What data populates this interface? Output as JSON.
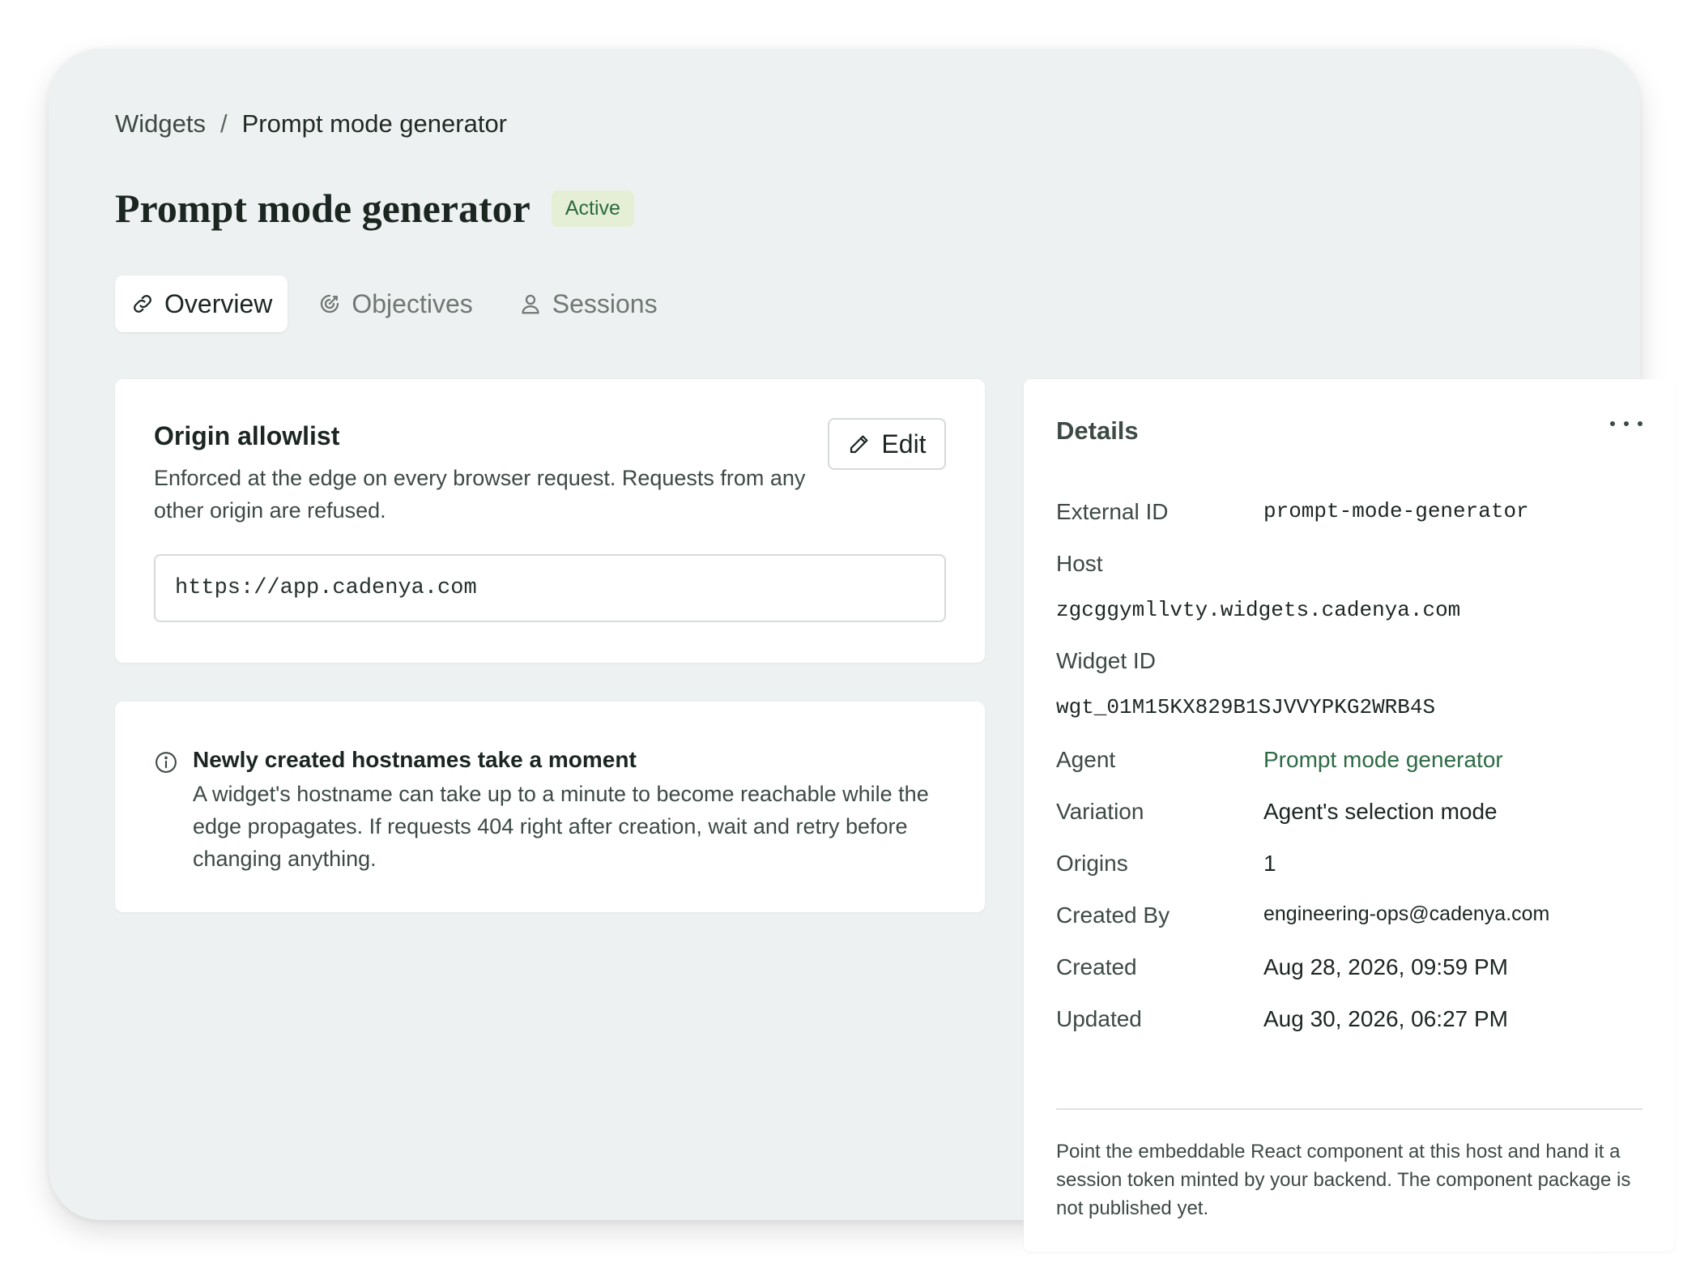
{
  "breadcrumb": {
    "parent": "Widgets",
    "separator": "/",
    "current": "Prompt mode generator"
  },
  "header": {
    "title": "Prompt mode generator",
    "status": "Active"
  },
  "tabs": [
    {
      "label": "Overview",
      "icon": "link-icon",
      "active": true
    },
    {
      "label": "Objectives",
      "icon": "target-icon",
      "active": false
    },
    {
      "label": "Sessions",
      "icon": "user-icon",
      "active": false
    }
  ],
  "allowlist": {
    "title": "Origin allowlist",
    "description": "Enforced at the edge on every browser request. Requests from any other origin are refused.",
    "edit_label": "Edit",
    "origin_value": "https://app.cadenya.com"
  },
  "note": {
    "title": "Newly created hostnames take a moment",
    "body": "A widget's hostname can take up to a minute to become reachable while the edge propagates. If requests 404 right after creation, wait and retry before changing anything."
  },
  "details": {
    "title": "Details",
    "external_id_label": "External ID",
    "external_id": "prompt-mode-generator",
    "host_label": "Host",
    "host": "zgcggymllvty.widgets.cadenya.com",
    "widget_id_label": "Widget ID",
    "widget_id": "wgt_01M15KX829B1SJVVYPKG2WRB4S",
    "agent_label": "Agent",
    "agent": "Prompt mode generator",
    "variation_label": "Variation",
    "variation": "Agent's selection mode",
    "origins_label": "Origins",
    "origins": "1",
    "created_by_label": "Created By",
    "created_by": "engineering-ops@cadenya.com",
    "created_label": "Created",
    "created": "Aug 28, 2026, 09:59 PM",
    "updated_label": "Updated",
    "updated": "Aug 30, 2026, 06:27 PM",
    "footer": "Point the embeddable React component at this host and hand it a session token minted by your backend. The component package is not published yet."
  },
  "colors": {
    "background": "#eef1f1",
    "badge_bg": "#e4efd6",
    "badge_text": "#2c6a3e",
    "link": "#2d6b45"
  }
}
